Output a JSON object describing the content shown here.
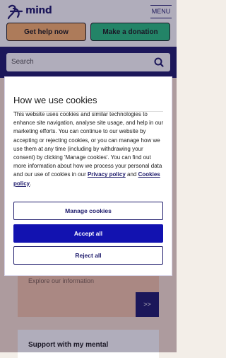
{
  "header": {
    "logo_text": "mind",
    "menu_label": "MENU",
    "get_help_label": "Get help now",
    "donate_label": "Make a donation"
  },
  "search": {
    "placeholder": "Search"
  },
  "page": {
    "explore_text": "Explore our information",
    "explore_button": ">>",
    "bottom_heading": "Support with my mental"
  },
  "cookie_modal": {
    "title": "How we use cookies",
    "body_text": "This website uses cookies and similar technologies to enhance site navigation, analyse site usage, and help in our marketing efforts. You can continue to our website by accepting or rejecting cookies, or you can manage how we use them at any time (including by withdrawing your consent) by clicking 'Manage cookies'. You can find out more information about how we process your personal data and our use of cookies in our",
    "privacy_link": "Privacy policy",
    "and_text": "and",
    "cookies_link": "Cookies policy",
    "manage_label": "Manage cookies",
    "accept_label": "Accept all",
    "reject_label": "Reject all"
  },
  "colors": {
    "brand_navy": "#1d1a6b",
    "help_orange": "#fbb26a",
    "donate_green": "#27c07f",
    "accept_blue": "#1212b0"
  },
  "icons": [
    "mind-logo-icon",
    "search-icon"
  ]
}
